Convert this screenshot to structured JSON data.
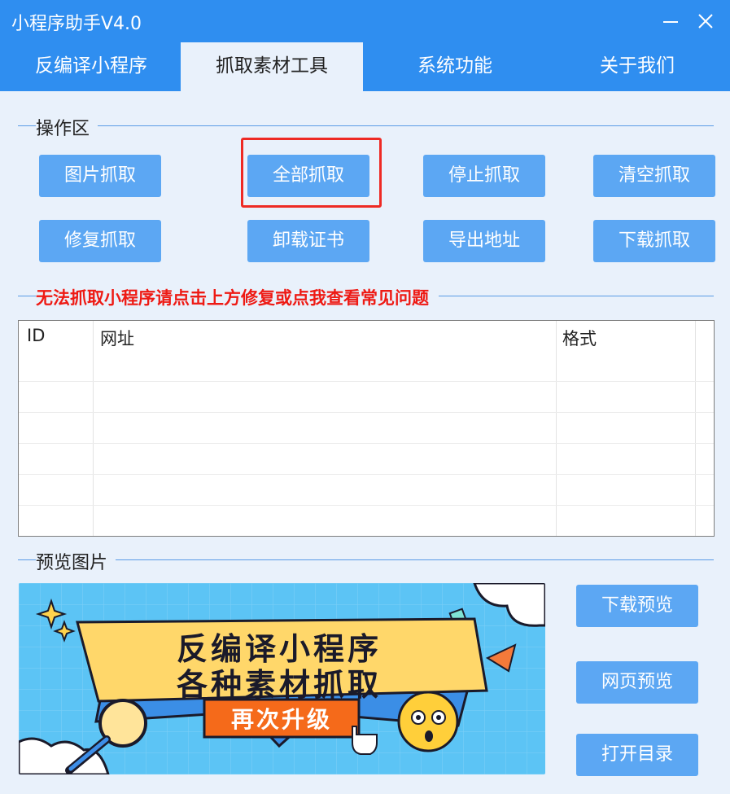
{
  "window": {
    "title": "小程序助手V4.0"
  },
  "tabs": [
    {
      "label": "反编译小程序",
      "active": false
    },
    {
      "label": "抓取素材工具",
      "active": true
    },
    {
      "label": "系统功能",
      "active": false
    },
    {
      "label": "关于我们",
      "active": false
    }
  ],
  "operation": {
    "section_label": "操作区",
    "buttons": [
      "图片抓取",
      "全部抓取",
      "停止抓取",
      "清空抓取",
      "修复抓取",
      "卸载证书",
      "导出地址",
      "下载抓取"
    ],
    "highlighted_button": "全部抓取"
  },
  "notice": {
    "text": "无法抓取小程序请点击上方修复或点我查看常见问题",
    "color": "#ee1a14"
  },
  "table": {
    "columns": [
      "ID",
      "网址",
      "格式"
    ],
    "rows": []
  },
  "preview": {
    "section_label": "预览图片",
    "banner": {
      "line1": "反编译小程序",
      "line2": "各种素材抓取",
      "badge": "再次升级"
    },
    "buttons": [
      "下载预览",
      "网页预览",
      "打开目录"
    ]
  },
  "colors": {
    "titlebar": "#2f8ef0",
    "button": "#5ca7f3",
    "background": "#e9f1fb",
    "highlight_border": "#ee2a24"
  }
}
